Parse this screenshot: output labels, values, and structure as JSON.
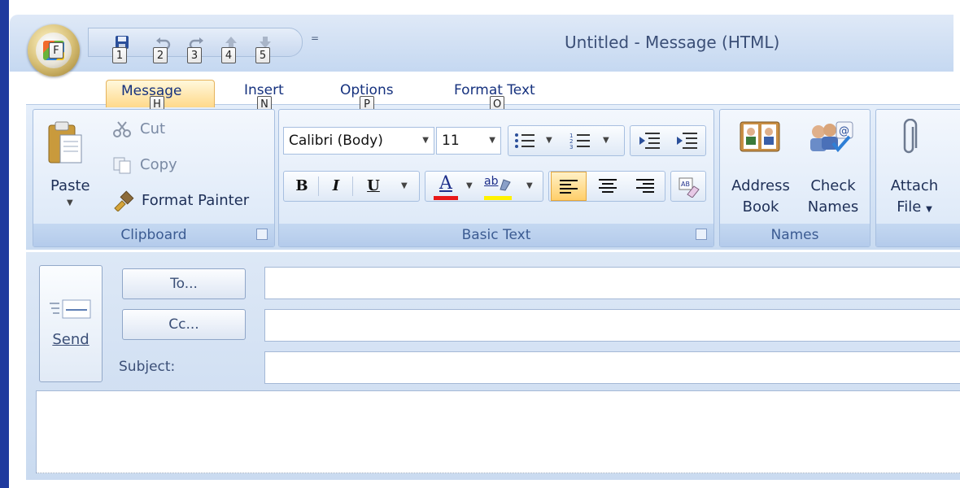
{
  "window": {
    "title": "Untitled - Message (HTML)"
  },
  "office_button": {
    "key_tip": "F"
  },
  "quick_access": {
    "key_tips": [
      "1",
      "2",
      "3",
      "4",
      "5"
    ],
    "icons": [
      "save-icon",
      "undo-icon",
      "redo-icon",
      "up-icon",
      "down-icon"
    ],
    "dropdown_glyph": "="
  },
  "tabs": [
    {
      "label": "Message",
      "key_tip": "H",
      "active": true
    },
    {
      "label": "Insert",
      "key_tip": "N",
      "active": false
    },
    {
      "label": "Options",
      "key_tip": "P",
      "active": false
    },
    {
      "label": "Format Text",
      "key_tip": "O",
      "active": false
    }
  ],
  "ribbon": {
    "clipboard": {
      "label": "Clipboard",
      "paste": "Paste",
      "cut": "Cut",
      "copy": "Copy",
      "format_painter": "Format Painter"
    },
    "basic_text": {
      "label": "Basic Text",
      "font_name": "Calibri (Body)",
      "font_size": "11",
      "bold": "B",
      "italic": "I",
      "underline": "U",
      "font_color": "A",
      "font_color_swatch": "#e81818",
      "highlight": "ab",
      "highlight_swatch": "#fff200",
      "align_left_active": true
    },
    "names": {
      "label": "Names",
      "address_book_1": "Address",
      "address_book_2": "Book",
      "check_names_1": "Check",
      "check_names_2": "Names"
    },
    "include": {
      "attach_1": "Attach",
      "attach_2": "File"
    }
  },
  "compose": {
    "send": "Send",
    "to": "To...",
    "cc": "Cc...",
    "subject_label": "Subject:",
    "to_value": "",
    "cc_value": "",
    "subject_value": "",
    "body": ""
  },
  "colors": {
    "background_blue": "#1f3a9e",
    "ribbon_blue": "#c9dbf1",
    "tab_active": "#ffd98a",
    "text_dark_blue": "#15317e"
  }
}
